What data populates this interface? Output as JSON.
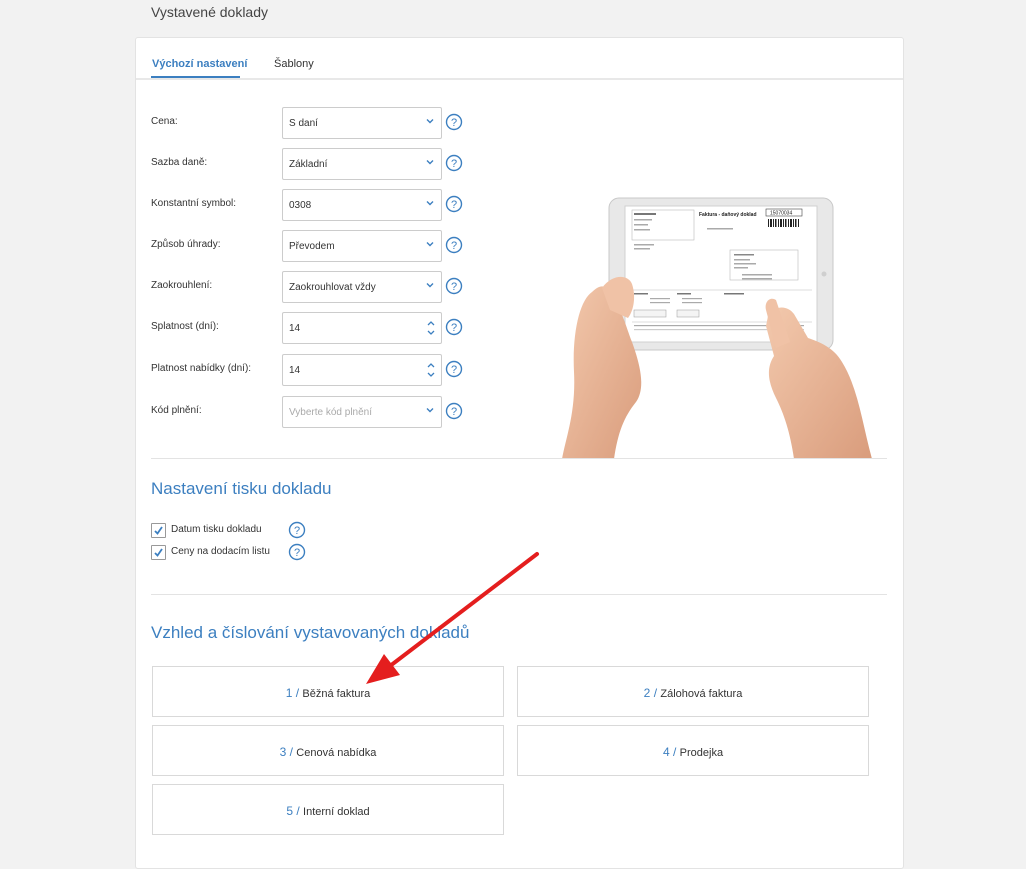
{
  "page": {
    "title": "Vystavené doklady"
  },
  "tabs": [
    {
      "label": "Výchozí nastavení",
      "active": true
    },
    {
      "label": "Šablony",
      "active": false
    }
  ],
  "form": {
    "rows": [
      {
        "label": "Cena:",
        "value": "S daní",
        "kind": "select"
      },
      {
        "label": "Sazba daně:",
        "value": "Základní",
        "kind": "select"
      },
      {
        "label": "Konstantní symbol:",
        "value": "0308",
        "kind": "select"
      },
      {
        "label": "Způsob úhrady:",
        "value": "Převodem",
        "kind": "select"
      },
      {
        "label": "Zaokrouhlení:",
        "value": "Zaokrouhlovat vždy",
        "kind": "select"
      },
      {
        "label": "Splatnost (dní):",
        "value": "14",
        "kind": "number"
      },
      {
        "label": "Platnost nabídky (dní):",
        "value": "14",
        "kind": "number"
      },
      {
        "label": "Kód plnění:",
        "placeholder": "Vyberte kód plnění",
        "kind": "select"
      }
    ]
  },
  "print_section": {
    "title": "Nastavení tisku dokladu",
    "options": [
      {
        "label": "Datum tisku dokladu",
        "checked": true
      },
      {
        "label": "Ceny na dodacím listu",
        "checked": true
      }
    ]
  },
  "numbering_section": {
    "title": "Vzhled a číslování vystavovaných dokladů",
    "documents": [
      {
        "number": "1",
        "name": "Běžná faktura"
      },
      {
        "number": "2",
        "name": "Zálohová faktura"
      },
      {
        "number": "3",
        "name": "Cenová nabídka"
      },
      {
        "number": "4",
        "name": "Prodejka"
      },
      {
        "number": "5",
        "name": "Interní doklad"
      }
    ]
  },
  "illustration": {
    "invoice_title": "Faktura - daňový doklad",
    "invoice_number": "15070034"
  },
  "colors": {
    "accent": "#3c7fc0",
    "arrow": "#e41e1e"
  },
  "icons": {
    "help": "question-circle-icon",
    "dropdown": "chevron-down-icon",
    "spinner": "spin-arrows-icon",
    "check": "checkmark-icon"
  }
}
